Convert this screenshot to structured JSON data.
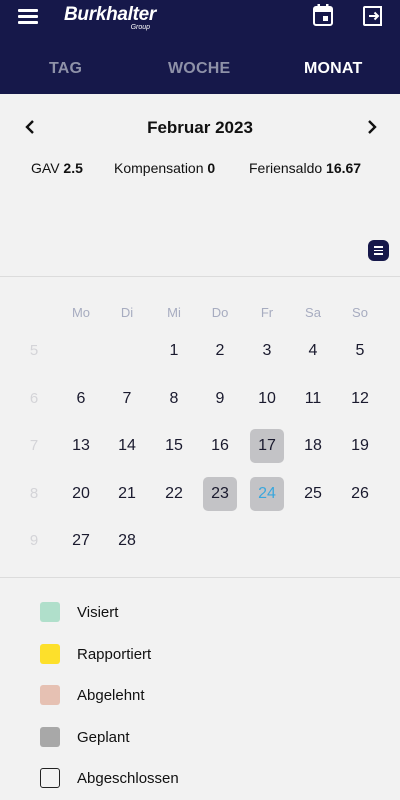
{
  "header": {
    "logo_main": "Burkhalter",
    "logo_sub": "Group",
    "icons": {
      "menu": "hamburger-menu-icon",
      "calendar": "calendar-icon",
      "logout": "logout-icon"
    },
    "background": "#16184a"
  },
  "tabs": [
    {
      "label": "TAG",
      "active": false
    },
    {
      "label": "WOCHE",
      "active": false
    },
    {
      "label": "MONAT",
      "active": true
    }
  ],
  "month_nav": {
    "title": "Februar 2023",
    "prev_icon": "chevron-left-icon",
    "next_icon": "chevron-right-icon"
  },
  "stats": [
    {
      "label": "GAV",
      "value": "2.5"
    },
    {
      "label": "Kompensation",
      "value": "0"
    },
    {
      "label": "Feriensaldo",
      "value": "16.67"
    }
  ],
  "list_button_icon": "list-icon",
  "weekdays": [
    "Mo",
    "Di",
    "Mi",
    "Do",
    "Fr",
    "Sa",
    "So"
  ],
  "weeks": [
    {
      "kw": "5",
      "days": [
        "",
        "",
        "1",
        "2",
        "3",
        "4",
        "5"
      ]
    },
    {
      "kw": "6",
      "days": [
        "6",
        "7",
        "8",
        "9",
        "10",
        "11",
        "12"
      ]
    },
    {
      "kw": "7",
      "days": [
        "13",
        "14",
        "15",
        "16",
        "17",
        "18",
        "19"
      ]
    },
    {
      "kw": "8",
      "days": [
        "20",
        "21",
        "22",
        "23",
        "24",
        "25",
        "26"
      ]
    },
    {
      "kw": "9",
      "days": [
        "27",
        "28",
        "",
        "",
        "",
        "",
        ""
      ]
    }
  ],
  "planned_days": [
    "17",
    "23",
    "24"
  ],
  "today": "24",
  "colors": {
    "planned": "#c3c3c6",
    "today_text": "#3aa7dd"
  },
  "legend": [
    {
      "label": "Visiert",
      "color": "#b0dfcb",
      "outline": false
    },
    {
      "label": "Rapportiert",
      "color": "#fde02b",
      "outline": false
    },
    {
      "label": "Abgelehnt",
      "color": "#e6c1b3",
      "outline": false
    },
    {
      "label": "Geplant",
      "color": "#a8a8a8",
      "outline": false
    },
    {
      "label": "Abgeschlossen",
      "color": "",
      "outline": true
    }
  ]
}
